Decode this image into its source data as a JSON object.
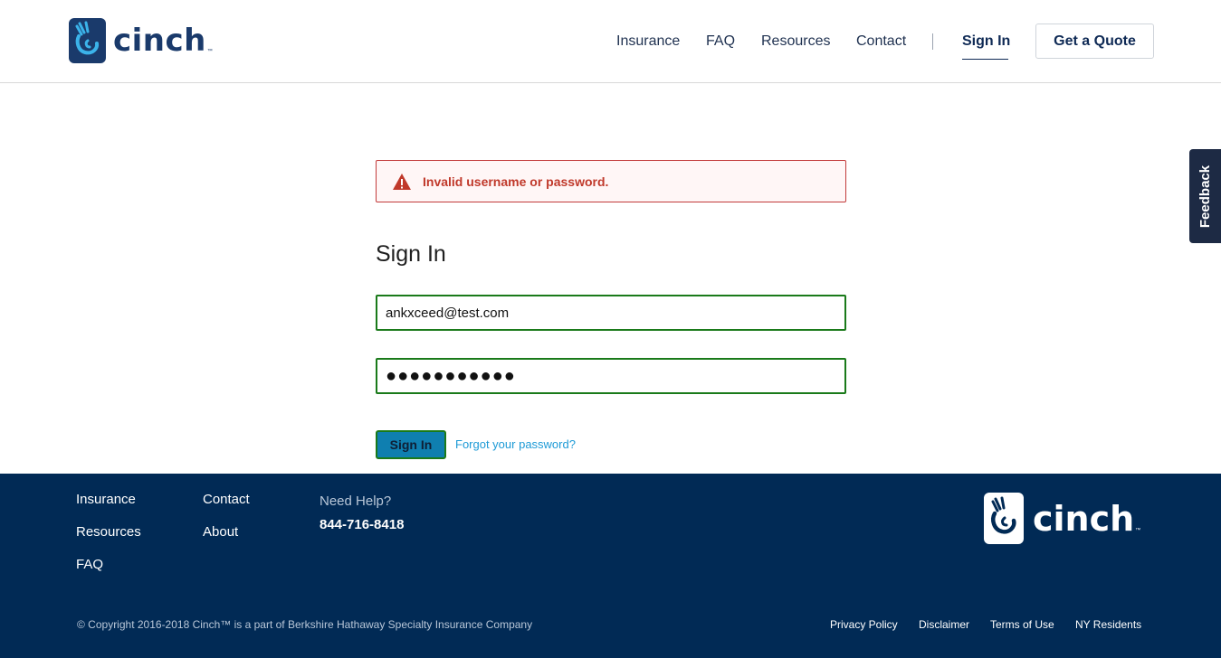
{
  "header": {
    "logo_text": "cinch",
    "logo_tm": "™",
    "nav": {
      "insurance": "Insurance",
      "faq": "FAQ",
      "resources": "Resources",
      "contact": "Contact",
      "sign_in": "Sign In"
    },
    "quote_button": "Get a Quote"
  },
  "feedback_tab": "Feedback",
  "alert": {
    "message": "Invalid username or password.",
    "icon": "warning-triangle-icon",
    "color": "#c0392b"
  },
  "form": {
    "title": "Sign In",
    "email_value": "ankxceed@test.com",
    "password_value": "●●●●●●●●●●●",
    "submit_label": "Sign In",
    "forgot_label": "Forgot your password?"
  },
  "footer": {
    "links": {
      "insurance": "Insurance",
      "resources": "Resources",
      "faq": "FAQ",
      "contact": "Contact",
      "about": "About"
    },
    "help_label": "Need Help?",
    "phone": "844-716-8418",
    "logo_text": "cinch",
    "logo_tm": "™",
    "copyright": "© Copyright 2016-2018 Cinch™ is a part of Berkshire Hathaway Specialty Insurance Company",
    "legal": {
      "privacy": "Privacy Policy",
      "disclaimer": "Disclaimer",
      "terms": "Terms of Use",
      "ny": "NY Residents"
    }
  },
  "colors": {
    "brand_navy": "#1a3a6b",
    "footer_bg": "#012a55",
    "link_blue": "#1d9ad6",
    "valid_green": "#1a7a1a"
  }
}
